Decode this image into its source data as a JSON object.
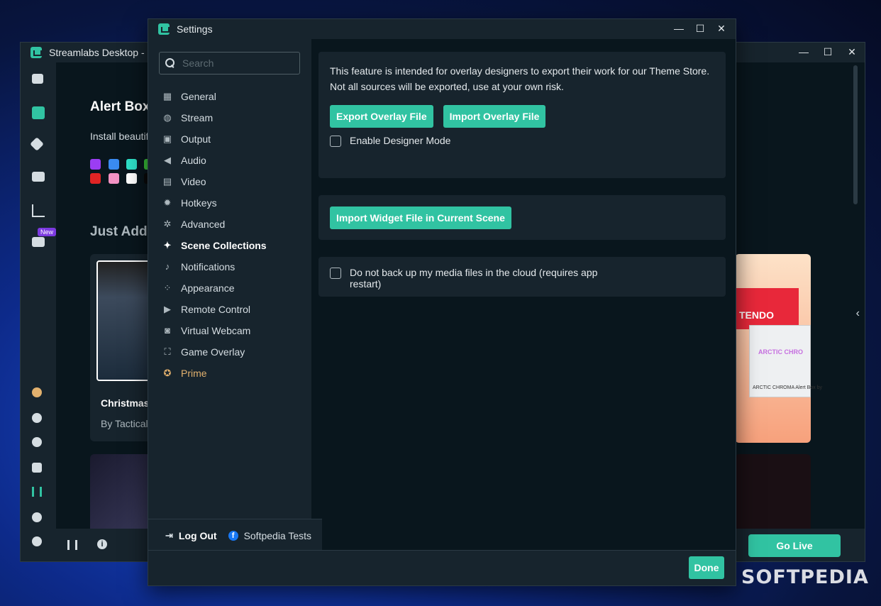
{
  "app": {
    "title": "Streamlabs Desktop - ",
    "main_title": "Alert Box",
    "main_sub": "Install beautif",
    "section_title": "Just Adde",
    "card1_title": "Christmas",
    "card1_author": "By Tactical",
    "card_right_lines": [
      "TENDO",
      "ARCTIC CHRO",
      "ARCTIC CHROMA Alert Box by"
    ],
    "go_live": "Go Live",
    "new_badge": "New",
    "colors": {
      "accent": "#31c3a2",
      "prime": "#e2b16e",
      "panel": "#17242d",
      "background": "#09161d"
    },
    "swatches": [
      "#9b3df3",
      "#3a8bf1",
      "#2ee0c7",
      "#3ac33a",
      "#e02424",
      "#f392c3",
      "#ffffff",
      "#0a0a0a"
    ]
  },
  "dialog": {
    "title": "Settings",
    "search_placeholder": "Search",
    "menu": [
      {
        "label": "General",
        "icon": "grid-icon"
      },
      {
        "label": "Stream",
        "icon": "globe-icon"
      },
      {
        "label": "Output",
        "icon": "chip-icon"
      },
      {
        "label": "Audio",
        "icon": "speaker-icon"
      },
      {
        "label": "Video",
        "icon": "film-icon"
      },
      {
        "label": "Hotkeys",
        "icon": "gear-icon"
      },
      {
        "label": "Advanced",
        "icon": "gears-icon"
      },
      {
        "label": "Scene Collections",
        "icon": "scenes-icon"
      },
      {
        "label": "Notifications",
        "icon": "bell-icon"
      },
      {
        "label": "Appearance",
        "icon": "appearance-icon"
      },
      {
        "label": "Remote Control",
        "icon": "play-icon"
      },
      {
        "label": "Virtual Webcam",
        "icon": "camera-icon"
      },
      {
        "label": "Game Overlay",
        "icon": "overlay-icon"
      },
      {
        "label": "Prime",
        "icon": "prime-icon"
      }
    ],
    "active_item": "Scene Collections",
    "logout": "Log Out",
    "account": "Softpedia Tests",
    "panel1_text_line1": "This feature is intended for overlay designers to export their work for our Theme Store.",
    "panel1_text_line2": "Not all sources will be exported, use at your own risk.",
    "export_btn": "Export Overlay File",
    "import_btn": "Import Overlay File",
    "designer_mode": "Enable Designer Mode",
    "import_widget_btn": "Import Widget File in Current Scene",
    "no_backup": "Do not back up my media files in the cloud (requires app",
    "no_backup_2": "restart)",
    "done": "Done"
  },
  "watermark": "SOFTPEDIA"
}
